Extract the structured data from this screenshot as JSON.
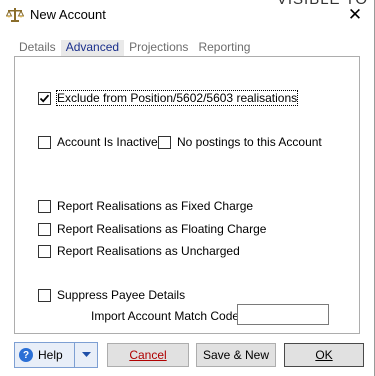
{
  "window": {
    "title": "New Account",
    "behind_text": "VISIBLE TO",
    "close_symbol": "✕",
    "icon": "scales-icon"
  },
  "tabs": [
    {
      "label": "Details",
      "active": false
    },
    {
      "label": "Advanced",
      "active": true
    },
    {
      "label": "Projections",
      "active": false
    },
    {
      "label": "Reporting",
      "active": false
    }
  ],
  "options": {
    "exclude_realisations": {
      "label": "Exclude from Position/5602/5603 realisations",
      "checked": true
    },
    "account_inactive": {
      "label": "Account Is Inactive",
      "checked": false
    },
    "no_postings": {
      "label": "No postings to this Account",
      "checked": false
    },
    "report_fixed": {
      "label": "Report Realisations as Fixed Charge",
      "checked": false
    },
    "report_floating": {
      "label": "Report Realisations as Floating Charge",
      "checked": false
    },
    "report_uncharged": {
      "label": "Report Realisations as Uncharged",
      "checked": false
    },
    "suppress_payee": {
      "label": "Suppress Payee Details",
      "checked": false
    }
  },
  "import_match": {
    "label": "Import Account Match Code:",
    "value": ""
  },
  "buttons": {
    "help": "Help",
    "cancel": "Cancel",
    "save_new": "Save & New",
    "ok": "OK"
  },
  "colors": {
    "active_tab_text": "#1a2f8c",
    "cancel_text": "#b00000",
    "help_icon": "#2a6fd6"
  }
}
